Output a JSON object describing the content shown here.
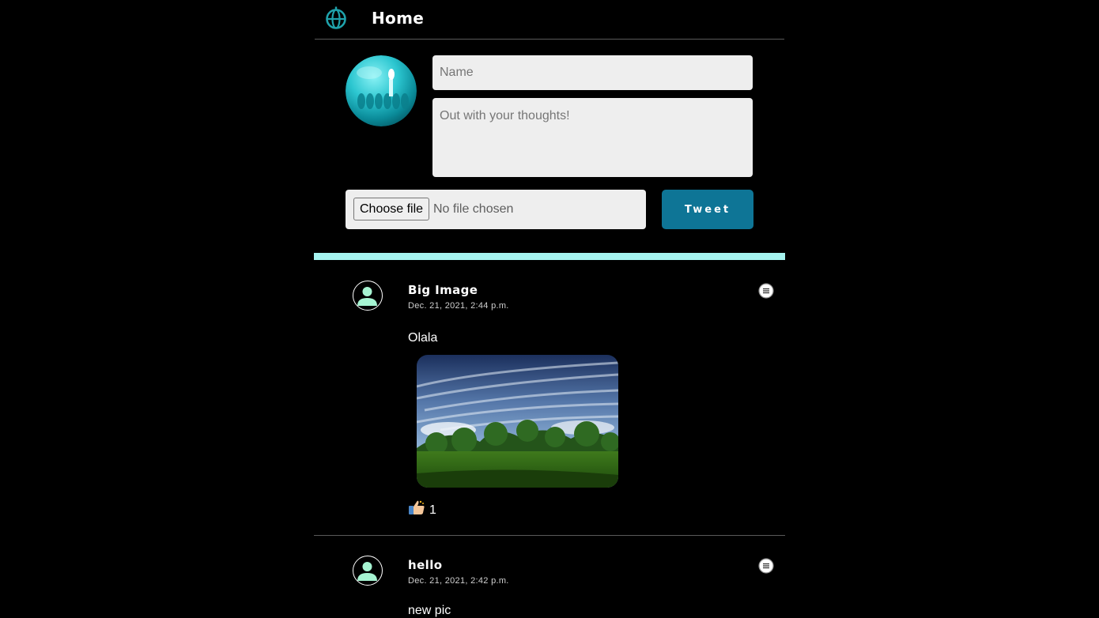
{
  "header": {
    "title": "Home",
    "logo_icon": "globe-logo-icon"
  },
  "composer": {
    "avatar": "teal-sphere-avatar",
    "name_placeholder": "Name",
    "thoughts_placeholder": "Out with your thoughts!",
    "choose_file_label": "Choose file",
    "no_file_label": "No file chosen",
    "tweet_label": "Tweet"
  },
  "colors": {
    "accent": "#0e7596",
    "divider": "#a6f4f0",
    "avatar_person": "#a6f4d2"
  },
  "posts": [
    {
      "author": "Big Image",
      "date": "Dec. 21, 2021, 2:44 p.m.",
      "text": "Olala",
      "image": "landscape-photo",
      "like_icon": "thumbs-up-icon",
      "likes": "1"
    },
    {
      "author": "hello",
      "date": "Dec. 21, 2021, 2:42 p.m.",
      "text": "new pic"
    }
  ]
}
